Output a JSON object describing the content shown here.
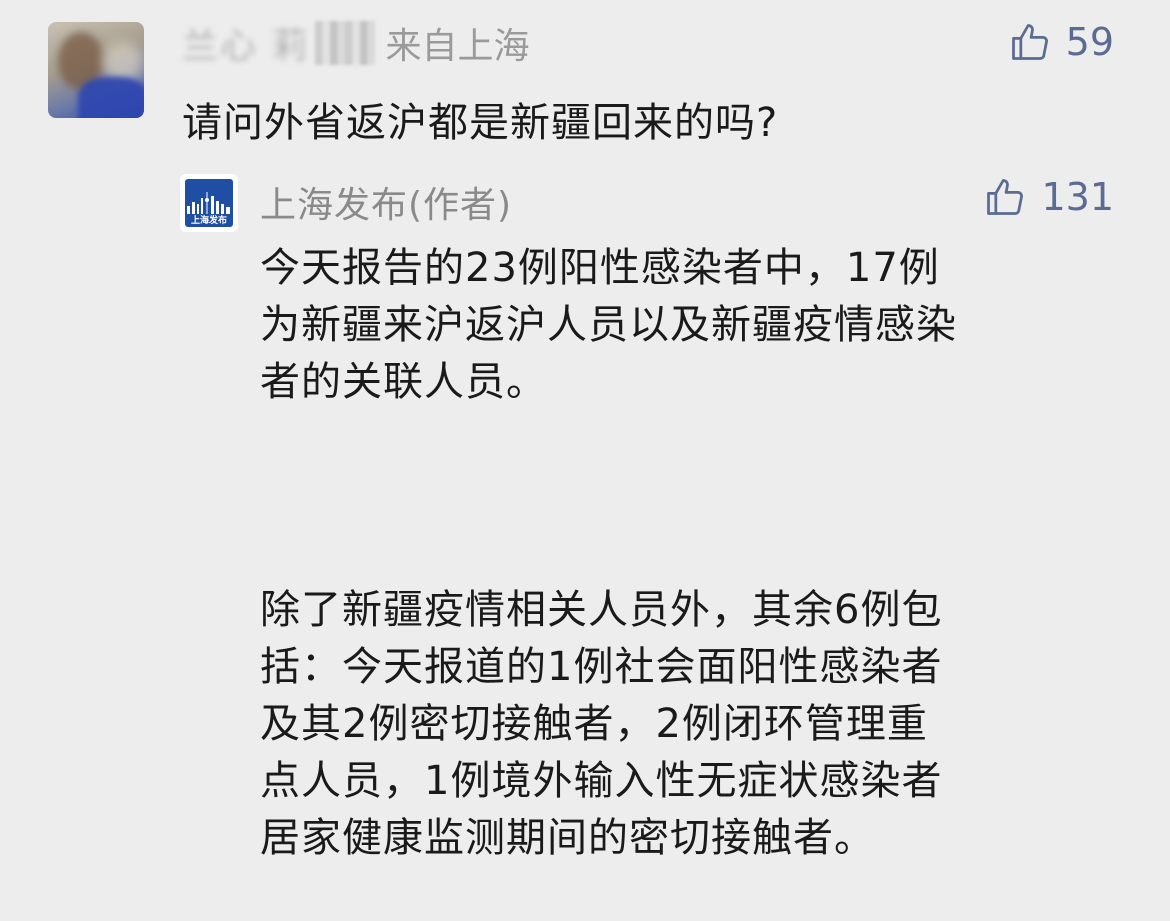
{
  "comment": {
    "username_obscured": "兰心 莉",
    "location": "来自上海",
    "text": "请问外省返沪都是新疆回来的吗?",
    "likes": "59"
  },
  "reply": {
    "author": "上海发布(作者)",
    "avatar_text": "上海发布",
    "likes": "131",
    "paragraph1": "今天报告的23例阳性感染者中，17例\n为新疆来沪返沪人员以及新疆疫情感染\n者的关联人员。",
    "paragraph2": "除了新疆疫情相关人员外，其余6例包\n括：今天报道的1例社会面阳性感染者\n及其2例密切接触者，2例闭环管理重\n点人员，1例境外输入性无症状感染者\n居家健康监测期间的密切接触者。"
  },
  "colors": {
    "background": "#ededed",
    "meta_text": "#9a9a9a",
    "like_icon": "#5b6c92",
    "body_text": "#1a1a1a",
    "brand_blue": "#1e4fa5"
  },
  "icons": {
    "like": "thumbs-up-icon"
  }
}
